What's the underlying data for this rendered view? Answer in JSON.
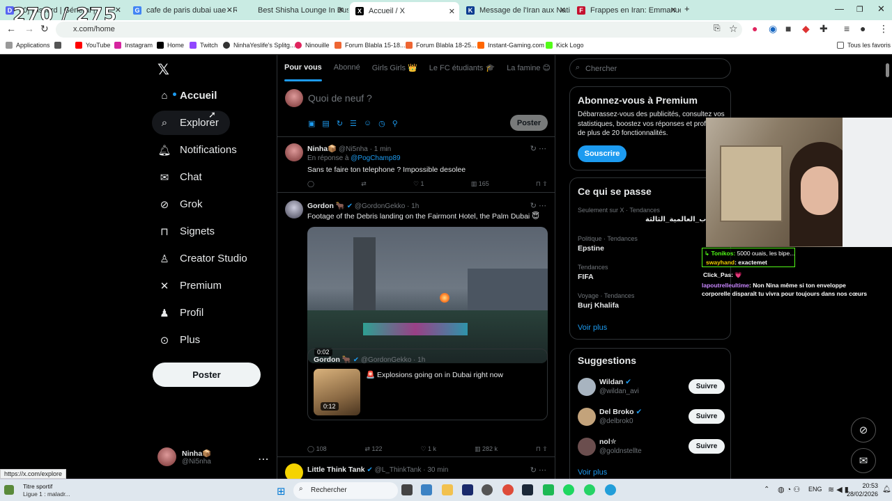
{
  "overlay_counter": "270 / 275",
  "tabs": [
    {
      "title": "30] Discord | Général |",
      "color": "#5865f2",
      "fav": "D"
    },
    {
      "title": "cafe de paris dubai uae - Reche",
      "color": "#4285f4",
      "fav": "G"
    },
    {
      "title": "Best Shisha Lounge In Business",
      "color": "#888",
      "fav": ""
    },
    {
      "title": "Accueil / X",
      "color": "#000",
      "fav": "X"
    },
    {
      "title": "Message de l'Iran aux Nations",
      "color": "#0c3d91",
      "fav": "K"
    },
    {
      "title": "Frappes en Iran: Emmanuel Ma",
      "color": "#c4122f",
      "fav": "F"
    }
  ],
  "address": {
    "url": "x.com/home"
  },
  "bookmarks": [
    {
      "label": "Applications",
      "color": "#888"
    },
    {
      "label": "",
      "color": "#555"
    },
    {
      "label": "YouTube",
      "color": "#ff0000"
    },
    {
      "label": "Instagram",
      "color": "#d6249f"
    },
    {
      "label": "Home",
      "color": "#000"
    },
    {
      "label": "Twitch",
      "color": "#9146ff"
    },
    {
      "label": "NinhaYeslife's Splitg...",
      "color": "#333"
    },
    {
      "label": "Ninouille",
      "color": "#e0245e"
    },
    {
      "label": "Forum Blabla 15-18...",
      "color": "#e63"
    },
    {
      "label": "Forum Blabla 18-25...",
      "color": "#e63"
    },
    {
      "label": "Instant-Gaming.com",
      "color": "#f60"
    },
    {
      "label": "Kick Logo",
      "color": "#53fc18"
    }
  ],
  "bookmarks_right": "Tous les favoris",
  "nav": [
    {
      "label": "Accueil",
      "icon": "home-icon",
      "glyph": "⌂"
    },
    {
      "label": "Explorer",
      "icon": "search-icon",
      "glyph": "⌕"
    },
    {
      "label": "Notifications",
      "icon": "bell-icon",
      "glyph": "♪"
    },
    {
      "label": "Chat",
      "icon": "mail-icon",
      "glyph": "✉"
    },
    {
      "label": "Grok",
      "icon": "grok-icon",
      "glyph": "⊘"
    },
    {
      "label": "Signets",
      "icon": "bookmark-icon",
      "glyph": "▯"
    },
    {
      "label": "Creator Studio",
      "icon": "creator-icon",
      "glyph": "♙"
    },
    {
      "label": "Premium",
      "icon": "x-icon",
      "glyph": "✕"
    },
    {
      "label": "Profil",
      "icon": "user-icon",
      "glyph": "♟"
    },
    {
      "label": "Plus",
      "icon": "more-icon",
      "glyph": "⋯"
    }
  ],
  "post_button": "Poster",
  "me": {
    "name": "Ninha📦",
    "handle": "@Ni5nha"
  },
  "feed_tabs": [
    "Pour vous",
    "Abonné",
    "Girls Girls 👑",
    "Le FC étudiants 🎓",
    "La famine 😊"
  ],
  "compose": {
    "placeholder": "Quoi de neuf ?",
    "button": "Poster"
  },
  "tweets": [
    {
      "name": "Ninha📦",
      "handle": "@Ni5nha · 1 min",
      "reply": "En réponse à ",
      "reply_to": "@PogChamp89",
      "text": "Sans te faire ton telephone ? Impossible desolee",
      "replies": "",
      "retweets": "",
      "likes": "1",
      "views": "165"
    },
    {
      "name": "Gordon 🐂",
      "handle": "@GordonGekko · 1h",
      "text": "Footage of the Debris landing on the Fairmont Hotel, the Palm Dubai 😇",
      "video_time": "0:02",
      "quote_name": "Gordon 🐂",
      "quote_handle": "@GordonGekko · 1h",
      "quote_text": "🚨 Explosions going on in Dubai right now",
      "quote_time": "0:12",
      "replies": "108",
      "retweets": "122",
      "likes": "1 k",
      "views": "282 k"
    },
    {
      "name": "Little Think Tank",
      "handle": "@L_ThinkTank · 30 min"
    }
  ],
  "search_placeholder": "Chercher",
  "premium": {
    "title": "Abonnez-vous à Premium",
    "body": "Débarrassez-vous des publicités, consultez vos statistiques, boostez vos réponses et profitez de plus de 20 fonctionnalités.",
    "button": "Souscrire"
  },
  "trends": {
    "title": "Ce qui se passe",
    "items": [
      {
        "context": "Seulement sur X · Tendances",
        "name": "ب_العالمية_الثالثة"
      },
      {
        "context": "Politique · Tendances",
        "name": "Epstine"
      },
      {
        "context": "Tendances",
        "name": "FIFA"
      },
      {
        "context": "Voyage · Tendances",
        "name": "Burj Khalifa"
      }
    ],
    "more": "Voir plus"
  },
  "suggestions": {
    "title": "Suggestions",
    "items": [
      {
        "name": "Wildan",
        "handle": "@wildan_avi",
        "button": "Suivre"
      },
      {
        "name": "Del Broko",
        "handle": "@delbrok0",
        "button": "Suivre"
      },
      {
        "name": "nol✮",
        "handle": "@goldnstellte",
        "button": "Suivre"
      }
    ],
    "more": "Voir plus"
  },
  "stream_chat": [
    {
      "user": "↳ Tonikos:",
      "msg": " 5000 ouais, les bipe..."
    },
    {
      "user": "swayhand",
      "msg": ": exactemet"
    },
    {
      "user": "Click_Pas",
      "msg": ": 💗"
    },
    {
      "user": "lapoutrelleultime",
      "msg": ": Non Nina même si ton enveloppe"
    },
    {
      "user": "",
      "msg": "corporelle disparaît tu vivra pour toujours dans nos cœurs"
    }
  ],
  "status_url": "https://x.com/explore",
  "taskbar": {
    "weather_title": "Titre sportif",
    "weather_sub": "Ligue 1 : maladr...",
    "search": "Rechercher",
    "lang": "ENG",
    "time": "20:53",
    "date": "28/02/2026"
  }
}
